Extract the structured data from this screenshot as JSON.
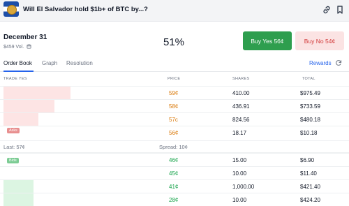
{
  "header": {
    "title": "Will El Salvador hold $1b+ of BTC by...?",
    "icons": [
      "link-icon",
      "bookmark-icon"
    ]
  },
  "market": {
    "date": "December 31",
    "volume": "$459 Vol.",
    "probability": "51%",
    "buy_yes": "Buy Yes 56¢",
    "buy_no": "Buy No 54¢"
  },
  "tabs": {
    "order_book": "Order Book",
    "graph": "Graph",
    "resolution": "Resolution",
    "rewards": "Rewards"
  },
  "columns": {
    "trade": "TRADE YES",
    "price": "PRICE",
    "shares": "SHARES",
    "total": "TOTAL"
  },
  "asks": [
    {
      "price": "59¢",
      "shares": "410.00",
      "total": "$975.49",
      "depth": 0.29
    },
    {
      "price": "58¢",
      "shares": "436.91",
      "total": "$733.59",
      "depth": 0.22
    },
    {
      "price": "57c",
      "shares": "824.56",
      "total": "$480.18",
      "depth": 0.15
    },
    {
      "price": "56¢",
      "shares": "18.17",
      "total": "$10.18",
      "depth": 0.0
    }
  ],
  "asks_badge": "Asks",
  "last": "Last: 57¢",
  "spread": "Spread: 10¢",
  "bids_badge": "Bids",
  "bids": [
    {
      "price": "46¢",
      "shares": "15.00",
      "total": "$6.90",
      "depth": 0.0
    },
    {
      "price": "45¢",
      "shares": "10.00",
      "total": "$11.40",
      "depth": 0.0
    },
    {
      "price": "41¢",
      "shares": "1,000.00",
      "total": "$421.40",
      "depth": 0.13
    },
    {
      "price": "28¢",
      "shares": "10.00",
      "total": "$424.20",
      "depth": 0.13
    }
  ],
  "colors": {
    "accent": "#2563eb",
    "yes": "#2e9e4e",
    "no": "#d33a3a",
    "ask_price": "#d97706",
    "bid_price": "#16a34a"
  }
}
